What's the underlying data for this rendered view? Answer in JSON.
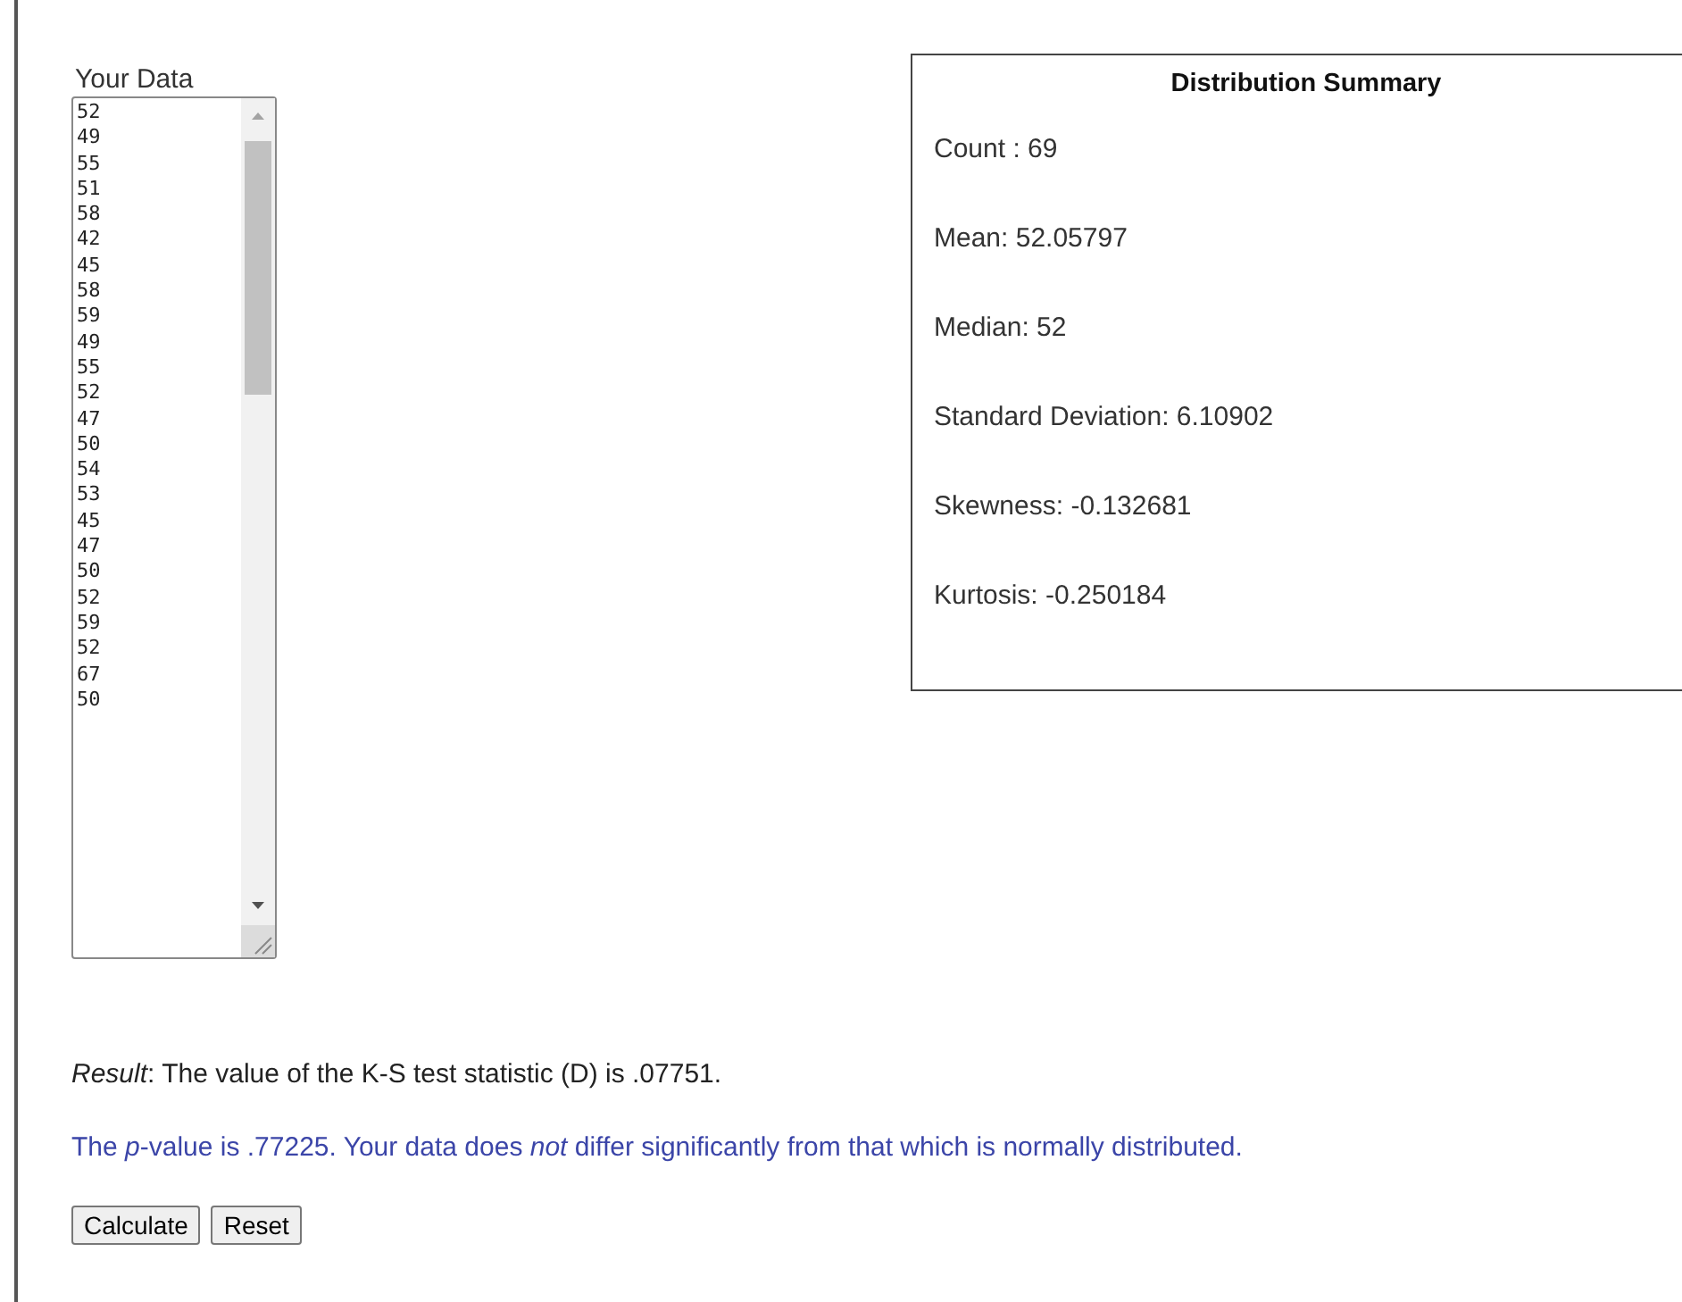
{
  "data_input": {
    "label": "Your Data",
    "values": [
      "52",
      "49",
      "55",
      "51",
      "58",
      "42",
      "45",
      "58",
      "59",
      "49",
      "55",
      "52",
      "47",
      "50",
      "54",
      "53",
      "45",
      "47",
      "50",
      "52",
      "59",
      "52",
      "67",
      "50"
    ]
  },
  "summary": {
    "title": "Distribution Summary",
    "items": [
      "Count : 69",
      "Mean: 52.05797",
      "Median: 52",
      "Standard Deviation: 6.10902",
      "Skewness: -0.132681",
      "Kurtosis: -0.250184"
    ]
  },
  "result": "*Result*: The value of the K-S test statistic (D) is .07751.",
  "conclusion": "The *p*-value is .77225. Your data does *not* differ significantly from that which is normally distributed.",
  "buttons": [
    "Calculate",
    "Reset"
  ]
}
